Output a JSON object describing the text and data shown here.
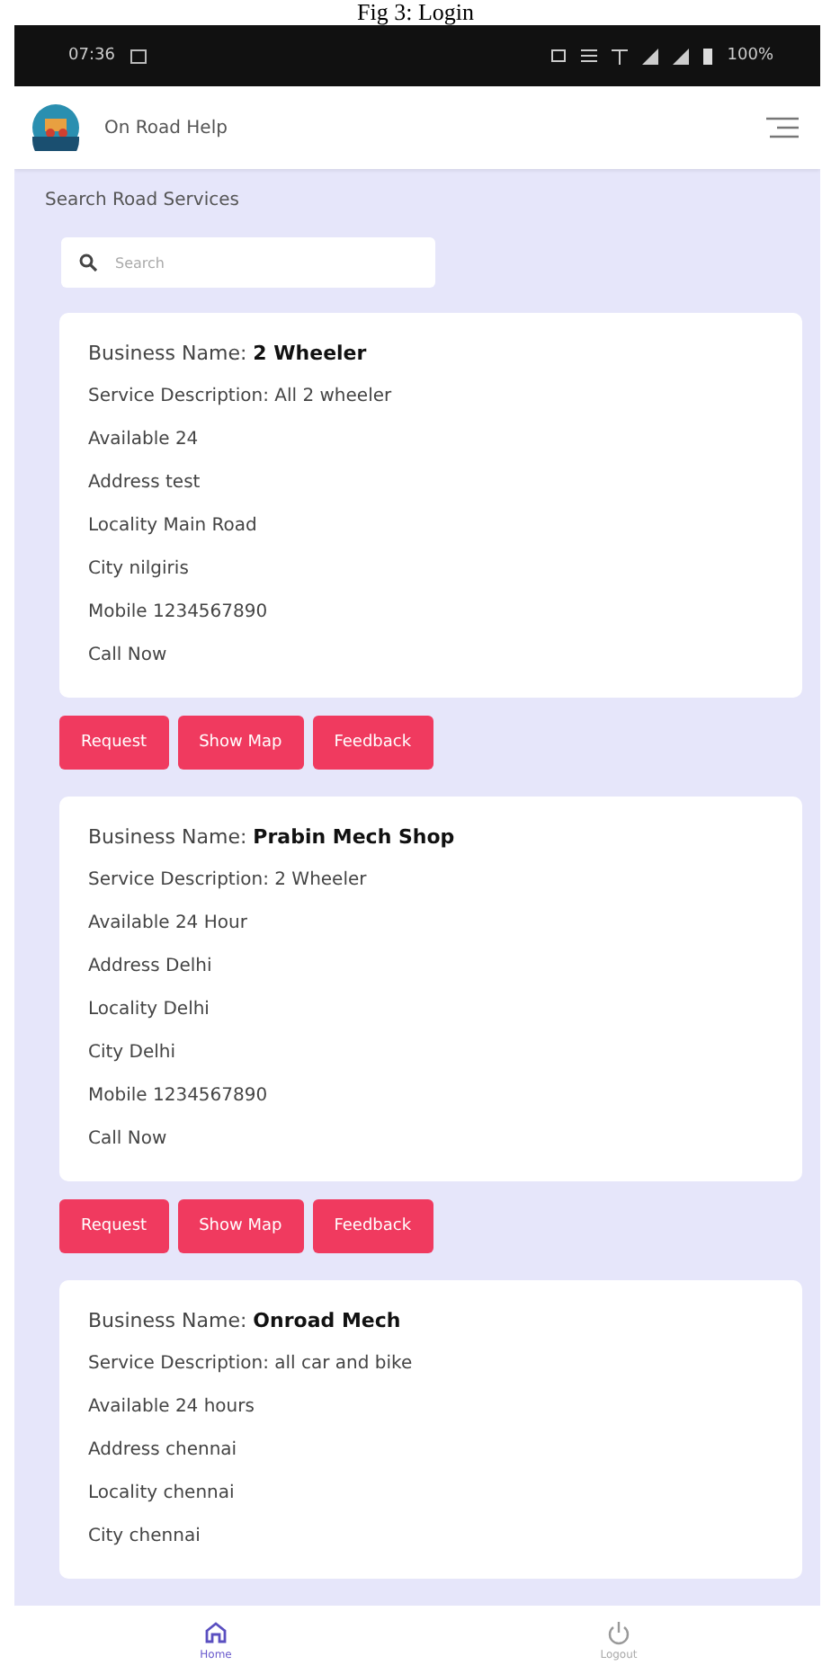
{
  "caption": "Fig 3: Login",
  "status_bar": {
    "time": "07:36",
    "battery": "100%"
  },
  "app_bar": {
    "title": "On Road Help"
  },
  "heading": "Search Road Services",
  "search": {
    "placeholder": "Search"
  },
  "listings": [
    {
      "name_label": "Business Name:",
      "name": "2 Wheeler",
      "details": [
        "Service Description: All 2 wheeler",
        "Available 24",
        "Address test",
        "Locality Main Road",
        "City nilgiris",
        "Mobile 1234567890",
        "Call Now"
      ],
      "buttons": [
        "Request",
        "Show Map",
        "Feedback"
      ]
    },
    {
      "name_label": "Business Name:",
      "name": "Prabin Mech Shop",
      "details": [
        "Service Description: 2 Wheeler",
        "Available 24 Hour",
        "Address Delhi",
        "Locality Delhi",
        "City Delhi",
        "Mobile 1234567890",
        "Call Now"
      ],
      "buttons": [
        "Request",
        "Show Map",
        "Feedback"
      ]
    },
    {
      "name_label": "Business Name:",
      "name": "Onroad Mech",
      "details": [
        "Service Description: all car and bike",
        "Available 24 hours",
        "Address chennai",
        "Locality chennai",
        "City chennai"
      ]
    }
  ],
  "nav": [
    {
      "label": "Home",
      "kind": "home",
      "selected": true
    },
    {
      "label": "Logout",
      "kind": "logout",
      "selected": false
    }
  ]
}
